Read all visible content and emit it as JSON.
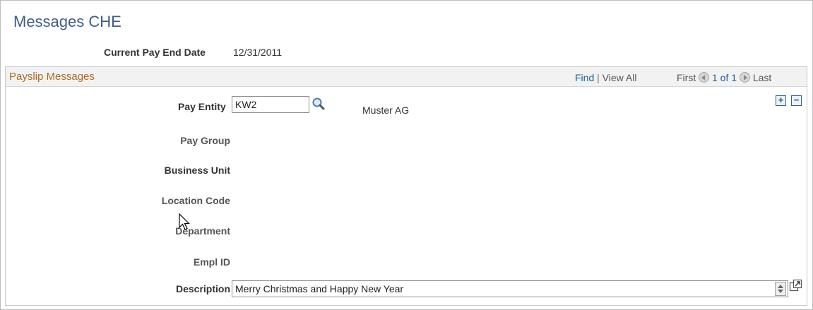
{
  "page": {
    "title": "Messages CHE"
  },
  "pay_end": {
    "label": "Current Pay End Date",
    "value": "12/31/2011"
  },
  "group": {
    "title": "Payslip Messages",
    "find": "Find",
    "separator": "|",
    "view_all": "View All",
    "first": "First",
    "count": "1 of 1",
    "last": "Last"
  },
  "fields": {
    "pay_entity": {
      "label": "Pay Entity",
      "value": "KW2",
      "description": "Muster AG"
    },
    "pay_group": {
      "label": "Pay Group"
    },
    "business_unit": {
      "label": "Business Unit"
    },
    "location_code": {
      "label": "Location Code"
    },
    "department": {
      "label": "Department"
    },
    "empl_id": {
      "label": "Empl ID"
    },
    "description": {
      "label": "Description",
      "value": "Merry Christmas and Happy New Year"
    }
  },
  "buttons": {
    "add": "+",
    "delete": "−"
  },
  "icons": {
    "lookup": "magnifier-icon",
    "prev": "previous-arrow-icon",
    "next": "next-arrow-icon",
    "spin": "spinner-icon",
    "expand": "expand-icon"
  }
}
